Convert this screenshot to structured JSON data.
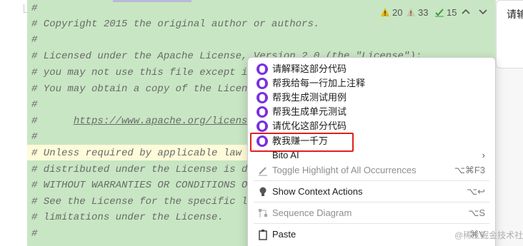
{
  "editor": {
    "lines": [
      {
        "text": "#"
      },
      {
        "text": "# Copyright 2015 the original author or authors."
      },
      {
        "text": "#"
      },
      {
        "text": "# Licensed under the Apache License, Version 2.0 (the \"License\");"
      },
      {
        "text": "# you may not use this file except in co"
      },
      {
        "text": "# You may obtain a copy of the License a"
      },
      {
        "text": "#"
      },
      {
        "text": "#      ",
        "link": "https://www.apache.org/licenses/L"
      },
      {
        "text": "#"
      },
      {
        "text": "# Unless required by applicable law or ",
        "sel": "a"
      },
      {
        "text": "# distributed under the License is distr"
      },
      {
        "text": "# WITHOUT WARRANTIES OR CONDITIONS OF AN"
      },
      {
        "text": "# See the License for the specific langu"
      },
      {
        "text": "# limitations under the License."
      },
      {
        "text": "#"
      }
    ],
    "inspections": {
      "warnings": "20",
      "weak_warnings": "33",
      "typos": "15"
    }
  },
  "right_panel": {
    "label": "请输"
  },
  "context_menu": {
    "bito_items": [
      "请解释这部分代码",
      "帮我给每一行加上注释",
      "帮我生成测试用例",
      "帮我生成单元测试",
      "请优化这部分代码",
      "教我赚一千万"
    ],
    "bito_ai": "Bito AI",
    "toggle_highlight": {
      "label": "Toggle Highlight of All Occurrences",
      "shortcut": "⌥⌘F3"
    },
    "show_context_actions": {
      "label": "Show Context Actions",
      "shortcut": "⌥↩"
    },
    "sequence_diagram": {
      "label": "Sequence Diagram",
      "shortcut": "⌥S"
    },
    "paste": {
      "label": "Paste",
      "shortcut": "⌘V"
    }
  },
  "watermark": "@稀土掘金技术社区",
  "colors": {
    "editor_bg": "#c8e6c3",
    "bito_purple": "#7b2fe0",
    "highlight_border": "#e02020"
  }
}
